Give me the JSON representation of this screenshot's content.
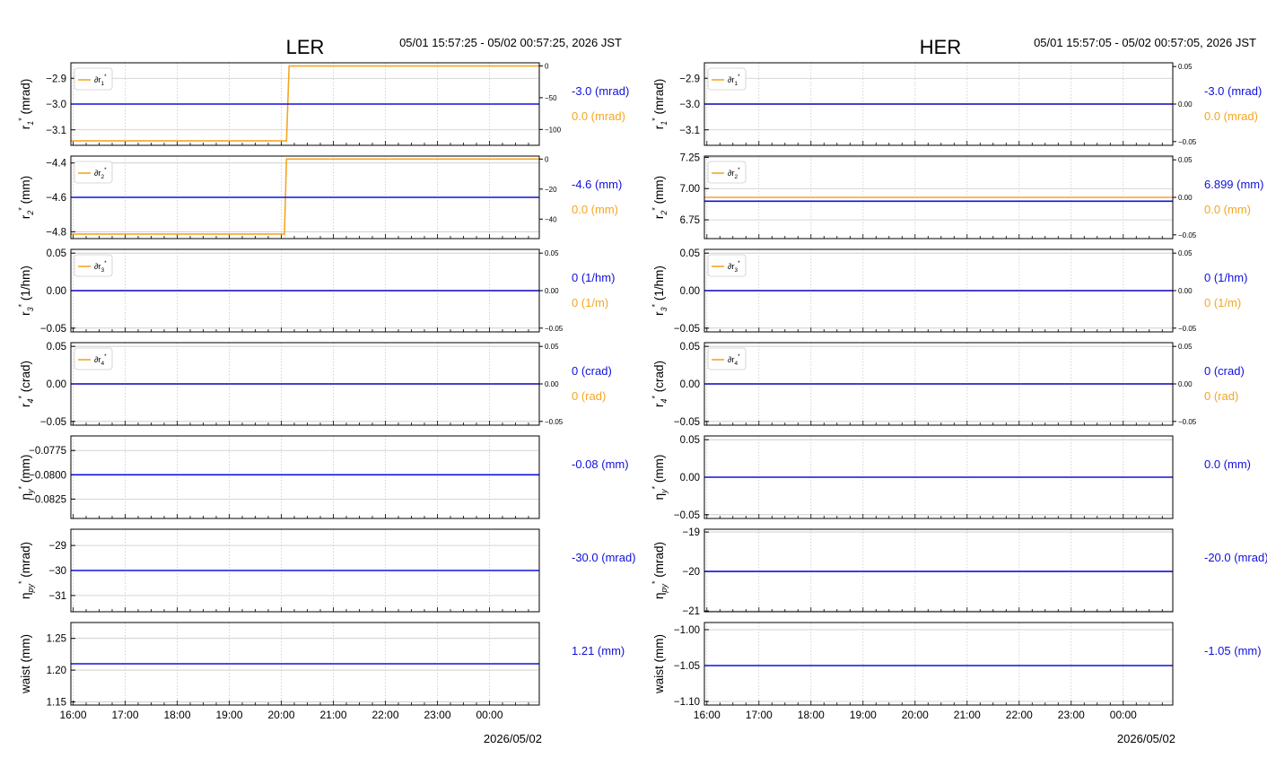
{
  "colors": {
    "primary": "#1010dd",
    "secondary": "#f5a623",
    "grid": "#c8c8c8",
    "axis": "#000000"
  },
  "panels": [
    {
      "name": "LER",
      "title": "LER",
      "time_range": "05/01 15:57:25 - 05/02 00:57:25, 2026 JST",
      "date_label": "2026/05/02"
    },
    {
      "name": "HER",
      "title": "HER",
      "time_range": "05/01 15:57:05 - 05/02 00:57:05, 2026 JST",
      "date_label": "2026/05/02"
    }
  ],
  "chart_data": [
    {
      "panel": "LER",
      "type": "line",
      "x_ticks": [
        "16:00",
        "17:00",
        "18:00",
        "19:00",
        "20:00",
        "21:00",
        "22:00",
        "23:00",
        "00:00"
      ],
      "x_range": [
        15.957,
        24.957
      ],
      "subplots": [
        {
          "ylabel_main": "r",
          "ylabel_sub": "1",
          "ylabel_unit": "(mrad)",
          "ylim": [
            -3.16,
            -2.84
          ],
          "yticks": [
            -3.1,
            -3.0,
            -2.9
          ],
          "ytick_labels": [
            "−3.1",
            "−3.0",
            "−2.9"
          ],
          "primary": {
            "x": [
              15.957,
              24.957
            ],
            "y": [
              -3.0,
              -3.0
            ]
          },
          "secondary": {
            "ylim": [
              -125,
              5
            ],
            "yticks": [
              -100,
              -50,
              0
            ],
            "ytick_labels": [
              "−100",
              "−50",
              "0"
            ],
            "x": [
              15.957,
              20.1,
              20.15,
              24.957
            ],
            "y": [
              -118,
              -118,
              0,
              0
            ]
          },
          "legend": "∂r",
          "legend_sub": "1",
          "value_primary": "-3.0 (mrad)",
          "value_secondary": "0.0 (mrad)"
        },
        {
          "ylabel_main": "r",
          "ylabel_sub": "2",
          "ylabel_unit": "(mm)",
          "ylim": [
            -4.84,
            -4.36
          ],
          "yticks": [
            -4.8,
            -4.6,
            -4.4
          ],
          "ytick_labels": [
            "−4.8",
            "−4.6",
            "−4.4"
          ],
          "primary": {
            "x": [
              15.957,
              24.957
            ],
            "y": [
              -4.6,
              -4.6
            ]
          },
          "secondary": {
            "ylim": [
              -53,
              2
            ],
            "yticks": [
              -40,
              -20,
              0
            ],
            "ytick_labels": [
              "−40",
              "−20",
              "0"
            ],
            "x": [
              15.957,
              20.06,
              20.1,
              24.957
            ],
            "y": [
              -50,
              -50,
              0,
              0
            ]
          },
          "legend": "∂r",
          "legend_sub": "2",
          "value_primary": "-4.6 (mm)",
          "value_secondary": "0.0 (mm)"
        },
        {
          "ylabel_main": "r",
          "ylabel_sub": "3",
          "ylabel_unit": "(1/hm)",
          "ylim": [
            -0.055,
            0.055
          ],
          "yticks": [
            -0.05,
            0.0,
            0.05
          ],
          "ytick_labels": [
            "−0.05",
            "0.00",
            "0.05"
          ],
          "primary": {
            "x": [
              15.957,
              24.957
            ],
            "y": [
              0,
              0
            ]
          },
          "secondary": {
            "ylim": [
              -0.055,
              0.055
            ],
            "yticks": [
              -0.05,
              0.0,
              0.05
            ],
            "ytick_labels": [
              "−0.05",
              "0.00",
              "0.05"
            ],
            "x": [
              15.957,
              24.957
            ],
            "y": [
              0,
              0
            ]
          },
          "legend": "∂r",
          "legend_sub": "3",
          "value_primary": "0 (1/hm)",
          "value_secondary": "0 (1/m)"
        },
        {
          "ylabel_main": "r",
          "ylabel_sub": "4",
          "ylabel_unit": "(crad)",
          "ylim": [
            -0.055,
            0.055
          ],
          "yticks": [
            -0.05,
            0.0,
            0.05
          ],
          "ytick_labels": [
            "−0.05",
            "0.00",
            "0.05"
          ],
          "primary": {
            "x": [
              15.957,
              24.957
            ],
            "y": [
              0,
              0
            ]
          },
          "secondary": {
            "ylim": [
              -0.055,
              0.055
            ],
            "yticks": [
              -0.05,
              0.0,
              0.05
            ],
            "ytick_labels": [
              "−0.05",
              "0.00",
              "0.05"
            ],
            "x": [
              15.957,
              24.957
            ],
            "y": [
              0,
              0
            ]
          },
          "legend": "∂r",
          "legend_sub": "4",
          "value_primary": "0 (crad)",
          "value_secondary": "0 (rad)"
        },
        {
          "ylabel_main": "η",
          "ylabel_sub": "y",
          "ylabel_unit": "(mm)",
          "ylim": [
            -0.0845,
            -0.076
          ],
          "yticks": [
            -0.0825,
            -0.08,
            -0.0775
          ],
          "ytick_labels": [
            "−0.0825",
            "−0.0800",
            "−0.0775"
          ],
          "primary": {
            "x": [
              15.957,
              24.957
            ],
            "y": [
              -0.08,
              -0.08
            ]
          },
          "value_primary": "-0.08 (mm)"
        },
        {
          "ylabel_main": "η",
          "ylabel_sub": "py",
          "ylabel_unit": "(mrad)",
          "ylim": [
            -31.65,
            -28.35
          ],
          "yticks": [
            -31,
            -30,
            -29
          ],
          "ytick_labels": [
            "−31",
            "−30",
            "−29"
          ],
          "primary": {
            "x": [
              15.957,
              24.957
            ],
            "y": [
              -30,
              -30
            ]
          },
          "value_primary": "-30.0 (mrad)"
        },
        {
          "ylabel_main": "waist",
          "ylabel_sub": "",
          "ylabel_unit": "(mm)",
          "ylim": [
            1.145,
            1.275
          ],
          "yticks": [
            1.15,
            1.2,
            1.25
          ],
          "ytick_labels": [
            "1.15",
            "1.20",
            "1.25"
          ],
          "primary": {
            "x": [
              15.957,
              24.957
            ],
            "y": [
              1.21,
              1.21
            ]
          },
          "value_primary": "1.21 (mm)"
        }
      ]
    },
    {
      "panel": "HER",
      "type": "line",
      "x_ticks": [
        "16:00",
        "17:00",
        "18:00",
        "19:00",
        "20:00",
        "21:00",
        "22:00",
        "23:00",
        "00:00"
      ],
      "x_range": [
        15.952,
        24.952
      ],
      "subplots": [
        {
          "ylabel_main": "r",
          "ylabel_sub": "1",
          "ylabel_unit": "(mrad)",
          "ylim": [
            -3.16,
            -2.84
          ],
          "yticks": [
            -3.1,
            -3.0,
            -2.9
          ],
          "ytick_labels": [
            "−3.1",
            "−3.0",
            "−2.9"
          ],
          "primary": {
            "x": [
              15.952,
              24.952
            ],
            "y": [
              -3.0,
              -3.0
            ]
          },
          "secondary": {
            "ylim": [
              -0.055,
              0.055
            ],
            "yticks": [
              -0.05,
              0.0,
              0.05
            ],
            "ytick_labels": [
              "−0.05",
              "0.00",
              "0.05"
            ],
            "x": [
              15.952,
              24.952
            ],
            "y": [
              0,
              0
            ]
          },
          "legend": "∂r",
          "legend_sub": "1",
          "value_primary": "-3.0 (mrad)",
          "value_secondary": "0.0 (mrad)"
        },
        {
          "ylabel_main": "r",
          "ylabel_sub": "2",
          "ylabel_unit": "(mm)",
          "ylim": [
            6.6,
            7.26
          ],
          "yticks": [
            6.75,
            7.0,
            7.25
          ],
          "ytick_labels": [
            "6.75",
            "7.00",
            "7.25"
          ],
          "primary": {
            "x": [
              15.952,
              24.952
            ],
            "y": [
              6.899,
              6.899
            ]
          },
          "secondary": {
            "ylim": [
              -0.055,
              0.055
            ],
            "yticks": [
              -0.05,
              0.0,
              0.05
            ],
            "ytick_labels": [
              "−0.05",
              "0.00",
              "0.05"
            ],
            "x": [
              15.952,
              24.952
            ],
            "y": [
              0,
              0
            ]
          },
          "legend": "∂r",
          "legend_sub": "2",
          "value_primary": "6.899 (mm)",
          "value_secondary": "0.0 (mm)"
        },
        {
          "ylabel_main": "r",
          "ylabel_sub": "3",
          "ylabel_unit": "(1/hm)",
          "ylim": [
            -0.055,
            0.055
          ],
          "yticks": [
            -0.05,
            0.0,
            0.05
          ],
          "ytick_labels": [
            "−0.05",
            "0.00",
            "0.05"
          ],
          "primary": {
            "x": [
              15.952,
              24.952
            ],
            "y": [
              0,
              0
            ]
          },
          "secondary": {
            "ylim": [
              -0.055,
              0.055
            ],
            "yticks": [
              -0.05,
              0.0,
              0.05
            ],
            "ytick_labels": [
              "−0.05",
              "0.00",
              "0.05"
            ],
            "x": [
              15.952,
              24.952
            ],
            "y": [
              0,
              0
            ]
          },
          "legend": "∂r",
          "legend_sub": "3",
          "value_primary": "0 (1/hm)",
          "value_secondary": "0 (1/m)"
        },
        {
          "ylabel_main": "r",
          "ylabel_sub": "4",
          "ylabel_unit": "(crad)",
          "ylim": [
            -0.055,
            0.055
          ],
          "yticks": [
            -0.05,
            0.0,
            0.05
          ],
          "ytick_labels": [
            "−0.05",
            "0.00",
            "0.05"
          ],
          "primary": {
            "x": [
              15.952,
              24.952
            ],
            "y": [
              0,
              0
            ]
          },
          "secondary": {
            "ylim": [
              -0.055,
              0.055
            ],
            "yticks": [
              -0.05,
              0.0,
              0.05
            ],
            "ytick_labels": [
              "−0.05",
              "0.00",
              "0.05"
            ],
            "x": [
              15.952,
              24.952
            ],
            "y": [
              0,
              0
            ]
          },
          "legend": "∂r",
          "legend_sub": "4",
          "value_primary": "0 (crad)",
          "value_secondary": "0 (rad)"
        },
        {
          "ylabel_main": "η",
          "ylabel_sub": "y",
          "ylabel_unit": "(mm)",
          "ylim": [
            -0.055,
            0.055
          ],
          "yticks": [
            -0.05,
            0.0,
            0.05
          ],
          "ytick_labels": [
            "−0.05",
            "0.00",
            "0.05"
          ],
          "primary": {
            "x": [
              15.952,
              24.952
            ],
            "y": [
              0,
              0
            ]
          },
          "value_primary": "0.0 (mm)"
        },
        {
          "ylabel_main": "η",
          "ylabel_sub": "py",
          "ylabel_unit": "(mrad)",
          "ylim": [
            -21.02,
            -18.93
          ],
          "yticks": [
            -21,
            -20,
            -19
          ],
          "ytick_labels": [
            "−21",
            "−20",
            "−19"
          ],
          "primary": {
            "x": [
              15.952,
              24.952
            ],
            "y": [
              -20,
              -20
            ]
          },
          "value_primary": "-20.0 (mrad)"
        },
        {
          "ylabel_main": "waist",
          "ylabel_sub": "",
          "ylabel_unit": "(mm)",
          "ylim": [
            -1.105,
            -0.99
          ],
          "yticks": [
            -1.1,
            -1.05,
            -1.0
          ],
          "ytick_labels": [
            "−1.10",
            "−1.05",
            "−1.00"
          ],
          "primary": {
            "x": [
              15.952,
              24.952
            ],
            "y": [
              -1.05,
              -1.05
            ]
          },
          "value_primary": "-1.05 (mm)"
        }
      ]
    }
  ]
}
